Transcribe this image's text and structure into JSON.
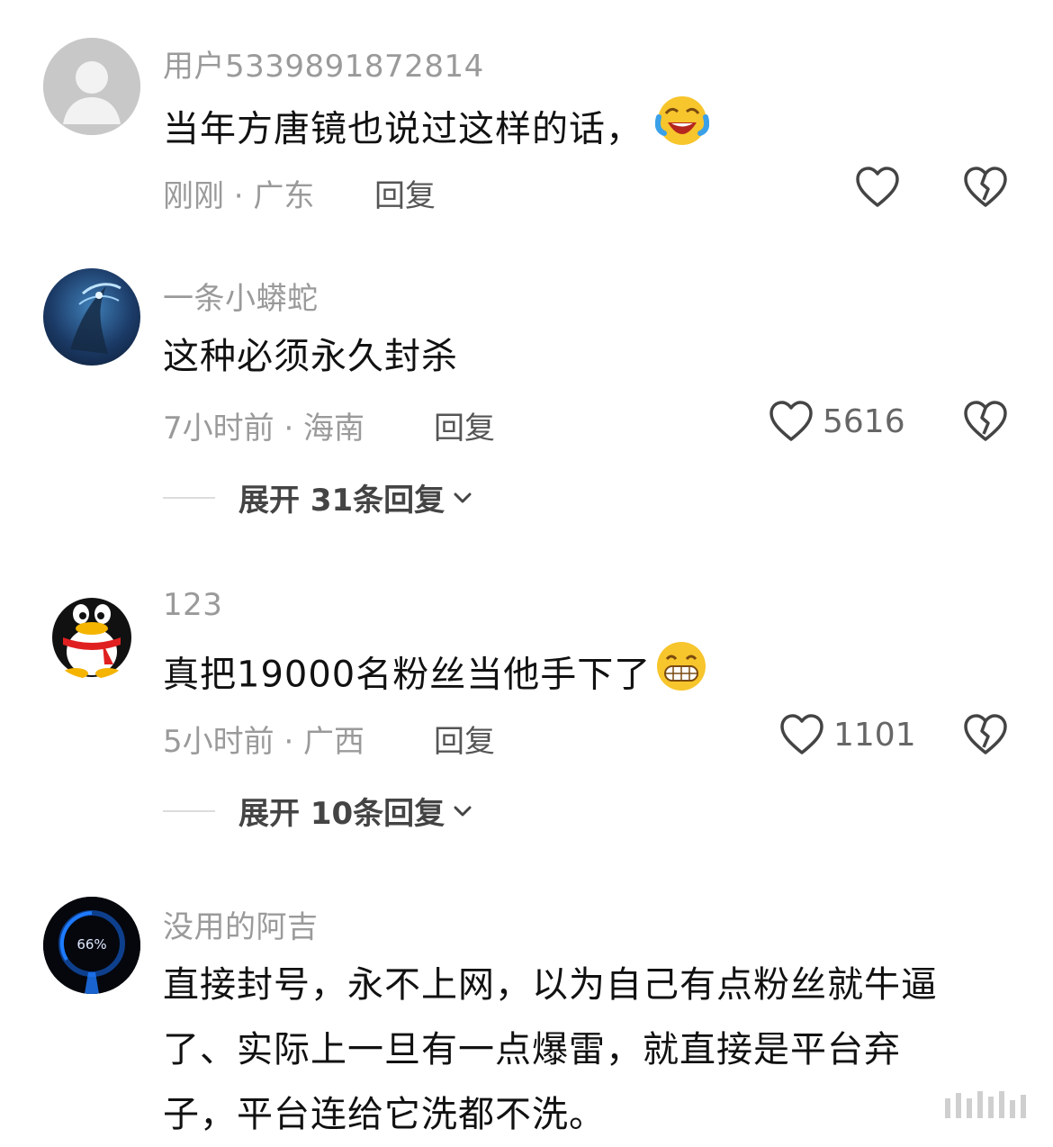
{
  "comments": [
    {
      "username": "用户5339891872814",
      "text": "当年方唐镜也说过这样的话，",
      "emoji": "laughing-face",
      "time_location": "刚刚 · 广东",
      "reply_label": "回复",
      "likes": ""
    },
    {
      "username": "一条小蟒蛇",
      "text": "这种必须永久封杀",
      "time_location": "7小时前 · 海南",
      "reply_label": "回复",
      "likes": "5616",
      "expand_label": "展开 31条回复"
    },
    {
      "username": "123",
      "text": "真把19000名粉丝当他手下了",
      "emoji": "grinning-face",
      "time_location": "5小时前 · 广西",
      "reply_label": "回复",
      "likes": "1101",
      "expand_label": "展开 10条回复"
    },
    {
      "username": "没用的阿吉",
      "avatar_text": "66%",
      "text_lines": [
        "直接封号，永不上网，以为自己有点粉丝就牛逼",
        "了、实际上一旦有一点爆雷，就直接是平台弃",
        "子，平台连给它洗都不洗。"
      ]
    }
  ],
  "colors": {
    "muted": "#9a9a9a",
    "text": "#111111",
    "icon": "#444444"
  }
}
